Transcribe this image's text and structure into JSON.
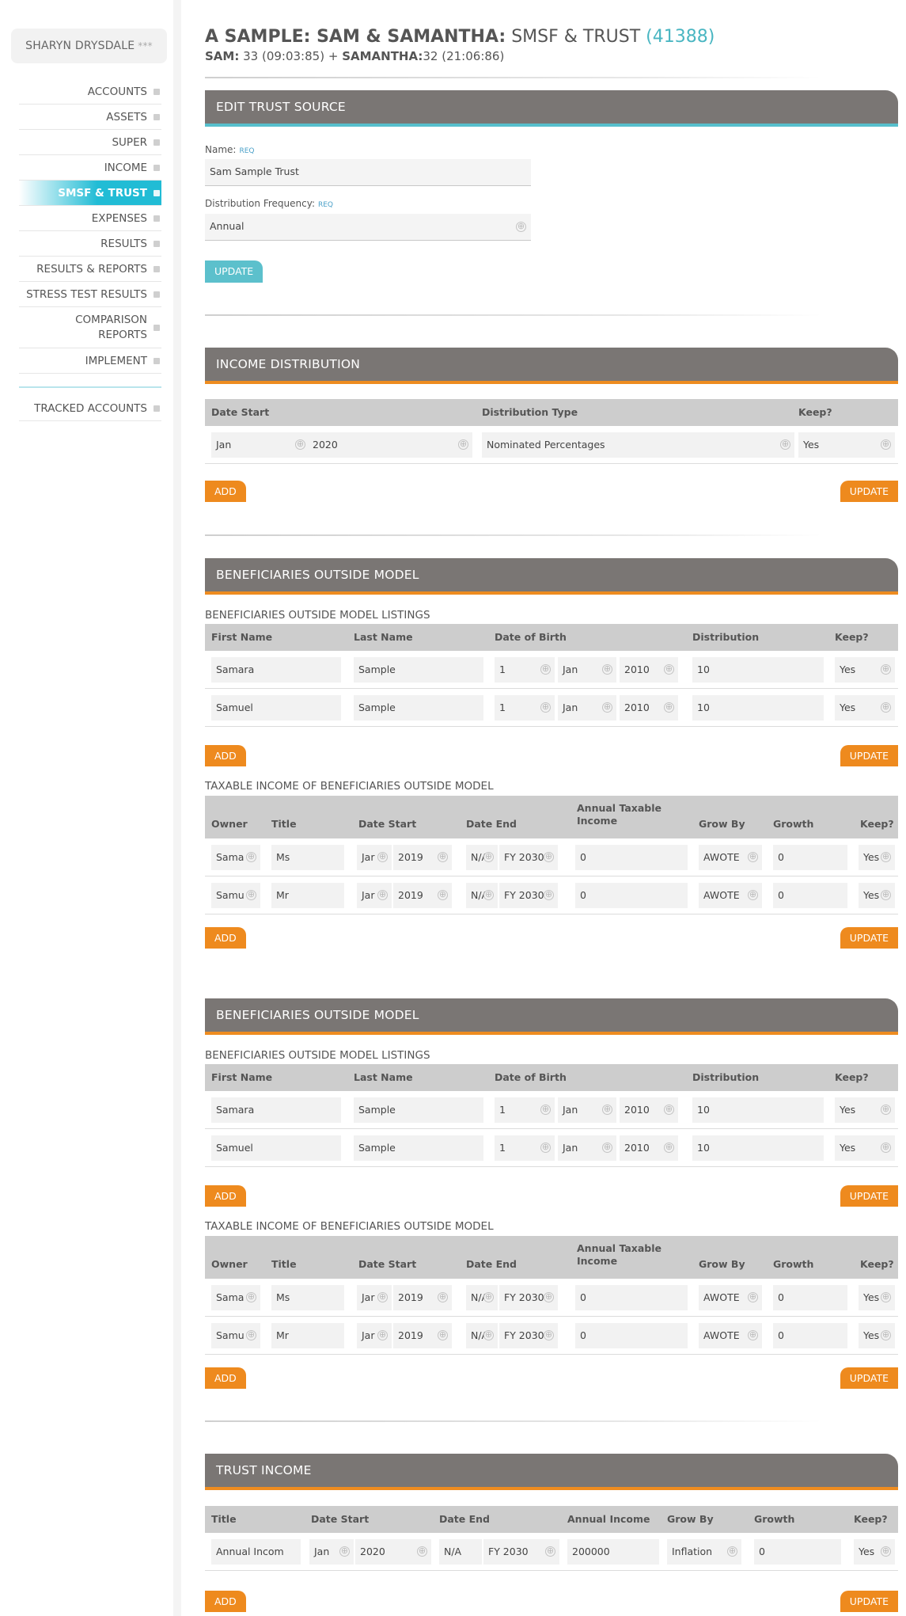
{
  "sidebar": {
    "user": "SHARYN DRYSDALE",
    "stars": "***",
    "items": [
      {
        "label": "ACCOUNTS"
      },
      {
        "label": "ASSETS"
      },
      {
        "label": "SUPER"
      },
      {
        "label": "INCOME"
      },
      {
        "label": "SMSF & TRUST",
        "active": true
      },
      {
        "label": "EXPENSES"
      },
      {
        "label": "RESULTS"
      },
      {
        "label": "RESULTS & REPORTS"
      },
      {
        "label": "STRESS TEST RESULTS"
      },
      {
        "label": "COMPARISON REPORTS"
      },
      {
        "label": "IMPLEMENT"
      }
    ],
    "tracked": "TRACKED ACCOUNTS"
  },
  "header": {
    "title_bold": "A SAMPLE: SAM & SAMANTHA:",
    "title_rest": "SMSF & TRUST",
    "title_number": "(41388)",
    "p1_name": "SAM:",
    "p1_detail": "33 (09:03:85)",
    "plus": "+",
    "p2_name": "SAMANTHA:",
    "p2_detail": "32 (21:06:86)"
  },
  "edit_trust": {
    "title": "EDIT TRUST SOURCE",
    "name_label": "Name:",
    "req": "REQ",
    "name_value": "Sam Sample Trust",
    "freq_label": "Distribution Frequency:",
    "freq_value": "Annual",
    "update": "UPDATE"
  },
  "income_distribution": {
    "title": "INCOME DISTRIBUTION",
    "headers": [
      "Date Start",
      "Distribution Type",
      "Keep?"
    ],
    "row": {
      "month": "Jan",
      "year": "2020",
      "type": "Nominated Percentages",
      "keep": "Yes"
    },
    "add": "ADD",
    "update": "UPDATE"
  },
  "beneficiaries_sections": [
    {
      "title": "BENEFICIARIES OUTSIDE MODEL",
      "listings_title": "BENEFICIARIES OUTSIDE MODEL LISTINGS",
      "listing_headers": [
        "First Name",
        "Last Name",
        "Date of Birth",
        "Distribution",
        "Keep?"
      ],
      "listings": [
        {
          "first": "Samara",
          "last": "Sample",
          "day": "1",
          "month": "Jan",
          "year": "2010",
          "dist": "10",
          "keep": "Yes"
        },
        {
          "first": "Samuel",
          "last": "Sample",
          "day": "1",
          "month": "Jan",
          "year": "2010",
          "dist": "10",
          "keep": "Yes"
        }
      ],
      "add": "ADD",
      "update": "UPDATE",
      "taxable_title": "TAXABLE INCOME OF BENEFICIARIES OUTSIDE MODEL",
      "taxable_headers": [
        "Owner",
        "Title",
        "Date Start",
        "Date End",
        "Annual Taxable Income",
        "Grow By",
        "Growth",
        "Keep?"
      ],
      "taxable": [
        {
          "owner": "Sama",
          "title": "Ms",
          "sm": "Jar",
          "sy": "2019",
          "em": "N/A",
          "ey": "FY 2030",
          "income": "0",
          "grow": "AWOTE",
          "growth": "0",
          "keep": "Yes"
        },
        {
          "owner": "Samu",
          "title": "Mr",
          "sm": "Jar",
          "sy": "2019",
          "em": "N/A",
          "ey": "FY 2030",
          "income": "0",
          "grow": "AWOTE",
          "growth": "0",
          "keep": "Yes"
        }
      ]
    },
    {
      "title": "BENEFICIARIES OUTSIDE MODEL",
      "listings_title": "BENEFICIARIES OUTSIDE MODEL LISTINGS",
      "listing_headers": [
        "First Name",
        "Last Name",
        "Date of Birth",
        "Distribution",
        "Keep?"
      ],
      "listings": [
        {
          "first": "Samara",
          "last": "Sample",
          "day": "1",
          "month": "Jan",
          "year": "2010",
          "dist": "10",
          "keep": "Yes"
        },
        {
          "first": "Samuel",
          "last": "Sample",
          "day": "1",
          "month": "Jan",
          "year": "2010",
          "dist": "10",
          "keep": "Yes"
        }
      ],
      "add": "ADD",
      "update": "UPDATE",
      "taxable_title": "TAXABLE INCOME OF BENEFICIARIES OUTSIDE MODEL",
      "taxable_headers": [
        "Owner",
        "Title",
        "Date Start",
        "Date End",
        "Annual Taxable Income",
        "Grow By",
        "Growth",
        "Keep?"
      ],
      "taxable": [
        {
          "owner": "Sama",
          "title": "Ms",
          "sm": "Jar",
          "sy": "2019",
          "em": "N/A",
          "ey": "FY 2030",
          "income": "0",
          "grow": "AWOTE",
          "growth": "0",
          "keep": "Yes"
        },
        {
          "owner": "Samu",
          "title": "Mr",
          "sm": "Jar",
          "sy": "2019",
          "em": "N/A",
          "ey": "FY 2030",
          "income": "0",
          "grow": "AWOTE",
          "growth": "0",
          "keep": "Yes"
        }
      ]
    }
  ],
  "trust_income": {
    "title": "TRUST INCOME",
    "headers": [
      "Title",
      "Date Start",
      "Date End",
      "Annual Income",
      "Grow By",
      "Growth",
      "Keep?"
    ],
    "row": {
      "title": "Annual Incom",
      "sm": "Jan",
      "sy": "2020",
      "em": "N/A",
      "ey": "FY 2030",
      "income": "200000",
      "grow": "Inflation",
      "growth": "0",
      "keep": "Yes"
    },
    "add": "ADD",
    "update": "UPDATE"
  },
  "icons": {
    "plus": "⊕"
  },
  "colors": {
    "teal": "#21bcd5",
    "orange": "#ee8a1e",
    "header_grey": "#7a7674"
  }
}
